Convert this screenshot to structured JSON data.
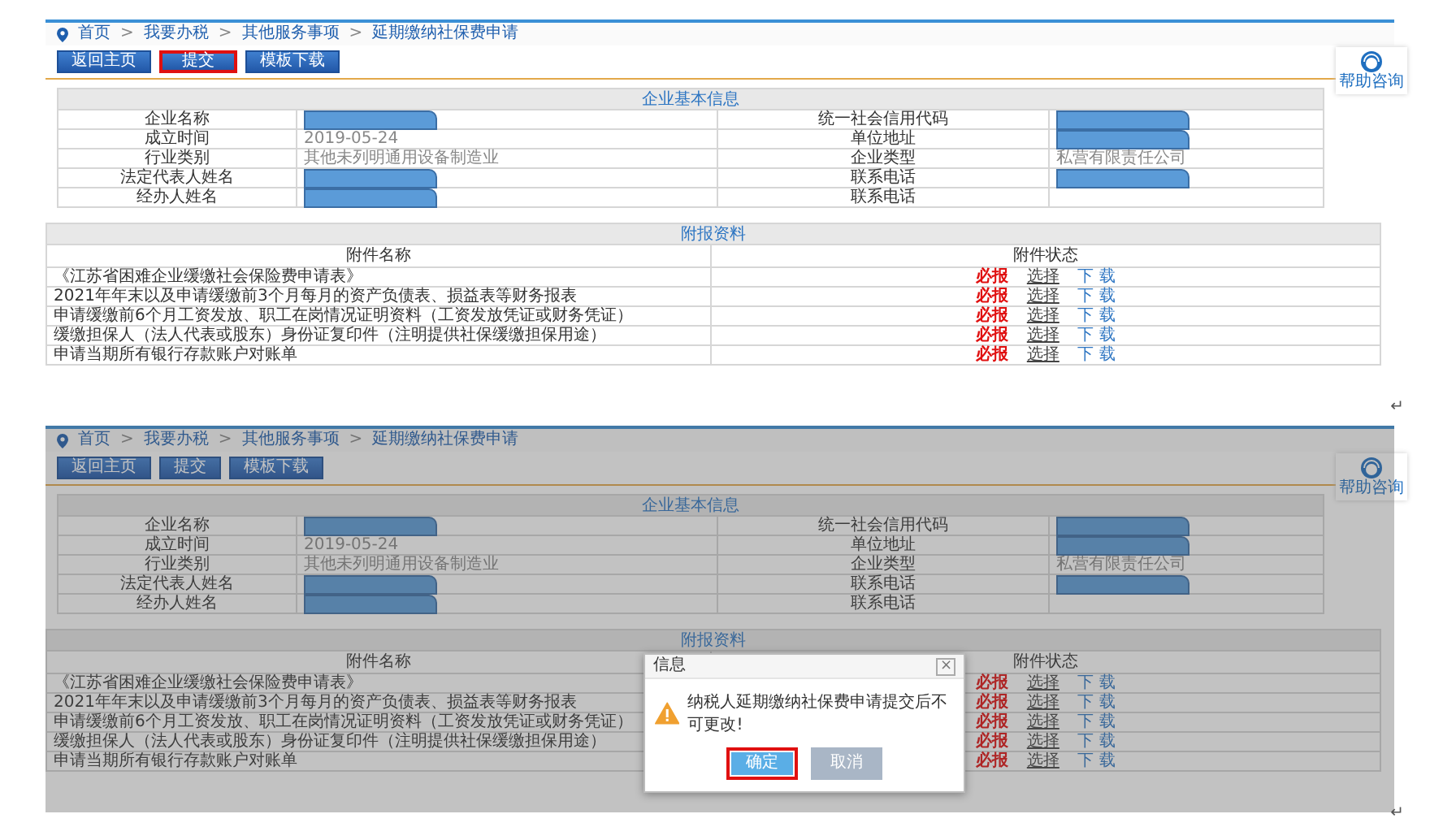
{
  "screens": [
    {
      "breadcrumb": [
        {
          "kind": "link",
          "text": "首页"
        },
        {
          "kind": "separator",
          "text": ">"
        },
        {
          "kind": "link",
          "text": "我要办税"
        },
        {
          "kind": "separator",
          "text": ">"
        },
        {
          "kind": "link",
          "text": "其他服务事项"
        },
        {
          "kind": "separator",
          "text": ">"
        },
        {
          "kind": "link",
          "text": "延期缴纳社保费申请"
        }
      ],
      "buttons": [
        {
          "label": "返回主页",
          "highlighted": false
        },
        {
          "label": "提交",
          "highlighted": true
        },
        {
          "label": "模板下载",
          "highlighted": false
        }
      ],
      "help": {
        "label": "帮助咨询"
      },
      "info": {
        "title": "企业基本信息",
        "rows": [
          {
            "cells": [
              {
                "text": "企业名称"
              },
              {
                "redacted": true
              },
              {
                "text": "统一社会信用代码"
              },
              {
                "redacted": true
              }
            ]
          },
          {
            "cells": [
              {
                "text": "成立时间"
              },
              {
                "text": "2019-05-24"
              },
              {
                "text": "单位地址"
              },
              {
                "redacted": true
              }
            ]
          },
          {
            "cells": [
              {
                "text": "行业类别"
              },
              {
                "text": "其他未列明通用设备制造业"
              },
              {
                "text": "企业类型"
              },
              {
                "text": "私营有限责任公司"
              }
            ]
          },
          {
            "cells": [
              {
                "text": "法定代表人姓名"
              },
              {
                "redacted": true
              },
              {
                "text": "联系电话"
              },
              {
                "redacted": true
              }
            ]
          },
          {
            "cells": [
              {
                "text": "经办人姓名"
              },
              {
                "redacted": true
              },
              {
                "text": "联系电话"
              },
              {}
            ]
          }
        ]
      },
      "attachments": {
        "title": "附报资料",
        "columns": [
          "附件名称",
          "附件状态"
        ],
        "rows": [
          {
            "name": "《江苏省困难企业缓缴社会保险费申请表》",
            "required": "必报",
            "choose": "选择",
            "download": "下 载"
          },
          {
            "name": "2021年年末以及申请缓缴前3个月每月的资产负债表、损益表等财务报表",
            "required": "必报",
            "choose": "选择",
            "download": "下 载"
          },
          {
            "name": "申请缓缴前6个月工资发放、职工在岗情况证明资料（工资发放凭证或财务凭证）",
            "required": "必报",
            "choose": "选择",
            "download": "下 载"
          },
          {
            "name": "缓缴担保人（法人代表或股东）身份证复印件（注明提供社保缓缴担保用途）",
            "required": "必报",
            "choose": "选择",
            "download": "下 载"
          },
          {
            "name": "申请当期所有银行存款账户对账单",
            "required": "必报",
            "choose": "选择",
            "download": "下 载"
          }
        ]
      },
      "dimmed": false,
      "paragraph_mark": "↵"
    },
    {
      "breadcrumb": [
        {
          "kind": "link",
          "text": "首页"
        },
        {
          "kind": "separator",
          "text": ">"
        },
        {
          "kind": "link",
          "text": "我要办税"
        },
        {
          "kind": "separator",
          "text": ">"
        },
        {
          "kind": "link",
          "text": "其他服务事项"
        },
        {
          "kind": "separator",
          "text": ">"
        },
        {
          "kind": "link",
          "text": "延期缴纳社保费申请"
        }
      ],
      "buttons": [
        {
          "label": "返回主页",
          "highlighted": false
        },
        {
          "label": "提交",
          "highlighted": false
        },
        {
          "label": "模板下载",
          "highlighted": false
        }
      ],
      "help": {
        "label": "帮助咨询"
      },
      "info": {
        "title": "企业基本信息",
        "rows": [
          {
            "cells": [
              {
                "text": "企业名称"
              },
              {
                "redacted": true
              },
              {
                "text": "统一社会信用代码"
              },
              {
                "redacted": true
              }
            ]
          },
          {
            "cells": [
              {
                "text": "成立时间"
              },
              {
                "text": "2019-05-24"
              },
              {
                "text": "单位地址"
              },
              {
                "redacted": true
              }
            ]
          },
          {
            "cells": [
              {
                "text": "行业类别"
              },
              {
                "text": "其他未列明通用设备制造业"
              },
              {
                "text": "企业类型"
              },
              {
                "text": "私营有限责任公司"
              }
            ]
          },
          {
            "cells": [
              {
                "text": "法定代表人姓名"
              },
              {
                "redacted": true
              },
              {
                "text": "联系电话"
              },
              {
                "redacted": true
              }
            ]
          },
          {
            "cells": [
              {
                "text": "经办人姓名"
              },
              {
                "redacted": true
              },
              {
                "text": "联系电话"
              },
              {}
            ]
          }
        ]
      },
      "attachments": {
        "title": "附报资料",
        "columns": [
          "附件名称",
          "附件状态"
        ],
        "rows": [
          {
            "name": "《江苏省困难企业缓缴社会保险费申请表》",
            "required": "必报",
            "choose": "选择",
            "download": "下 载"
          },
          {
            "name": "2021年年末以及申请缓缴前3个月每月的资产负债表、损益表等财务报表",
            "required": "必报",
            "choose": "选择",
            "download": "下 载"
          },
          {
            "name": "申请缓缴前6个月工资发放、职工在岗情况证明资料（工资发放凭证或财务凭证）",
            "required": "必报",
            "choose": "选择",
            "download": "下 载"
          },
          {
            "name": "缓缴担保人（法人代表或股东）身份证复印件（注明提供社保缓缴担保用途）",
            "required": "必报",
            "choose": "选择",
            "download": "下 载"
          },
          {
            "name": "申请当期所有银行存款账户对账单",
            "required": "必报",
            "choose": "选择",
            "download": "下 载"
          }
        ]
      },
      "dimmed": true,
      "dialog": {
        "title": "信息",
        "close": "×",
        "message": "纳税人延期缴纳社保费申请提交后不可更改!",
        "buttons": [
          {
            "kind": "primary",
            "label": "确定",
            "highlighted": true
          },
          {
            "kind": "secondary",
            "label": "取消",
            "highlighted": false
          }
        ]
      },
      "paragraph_mark": "↵"
    }
  ]
}
